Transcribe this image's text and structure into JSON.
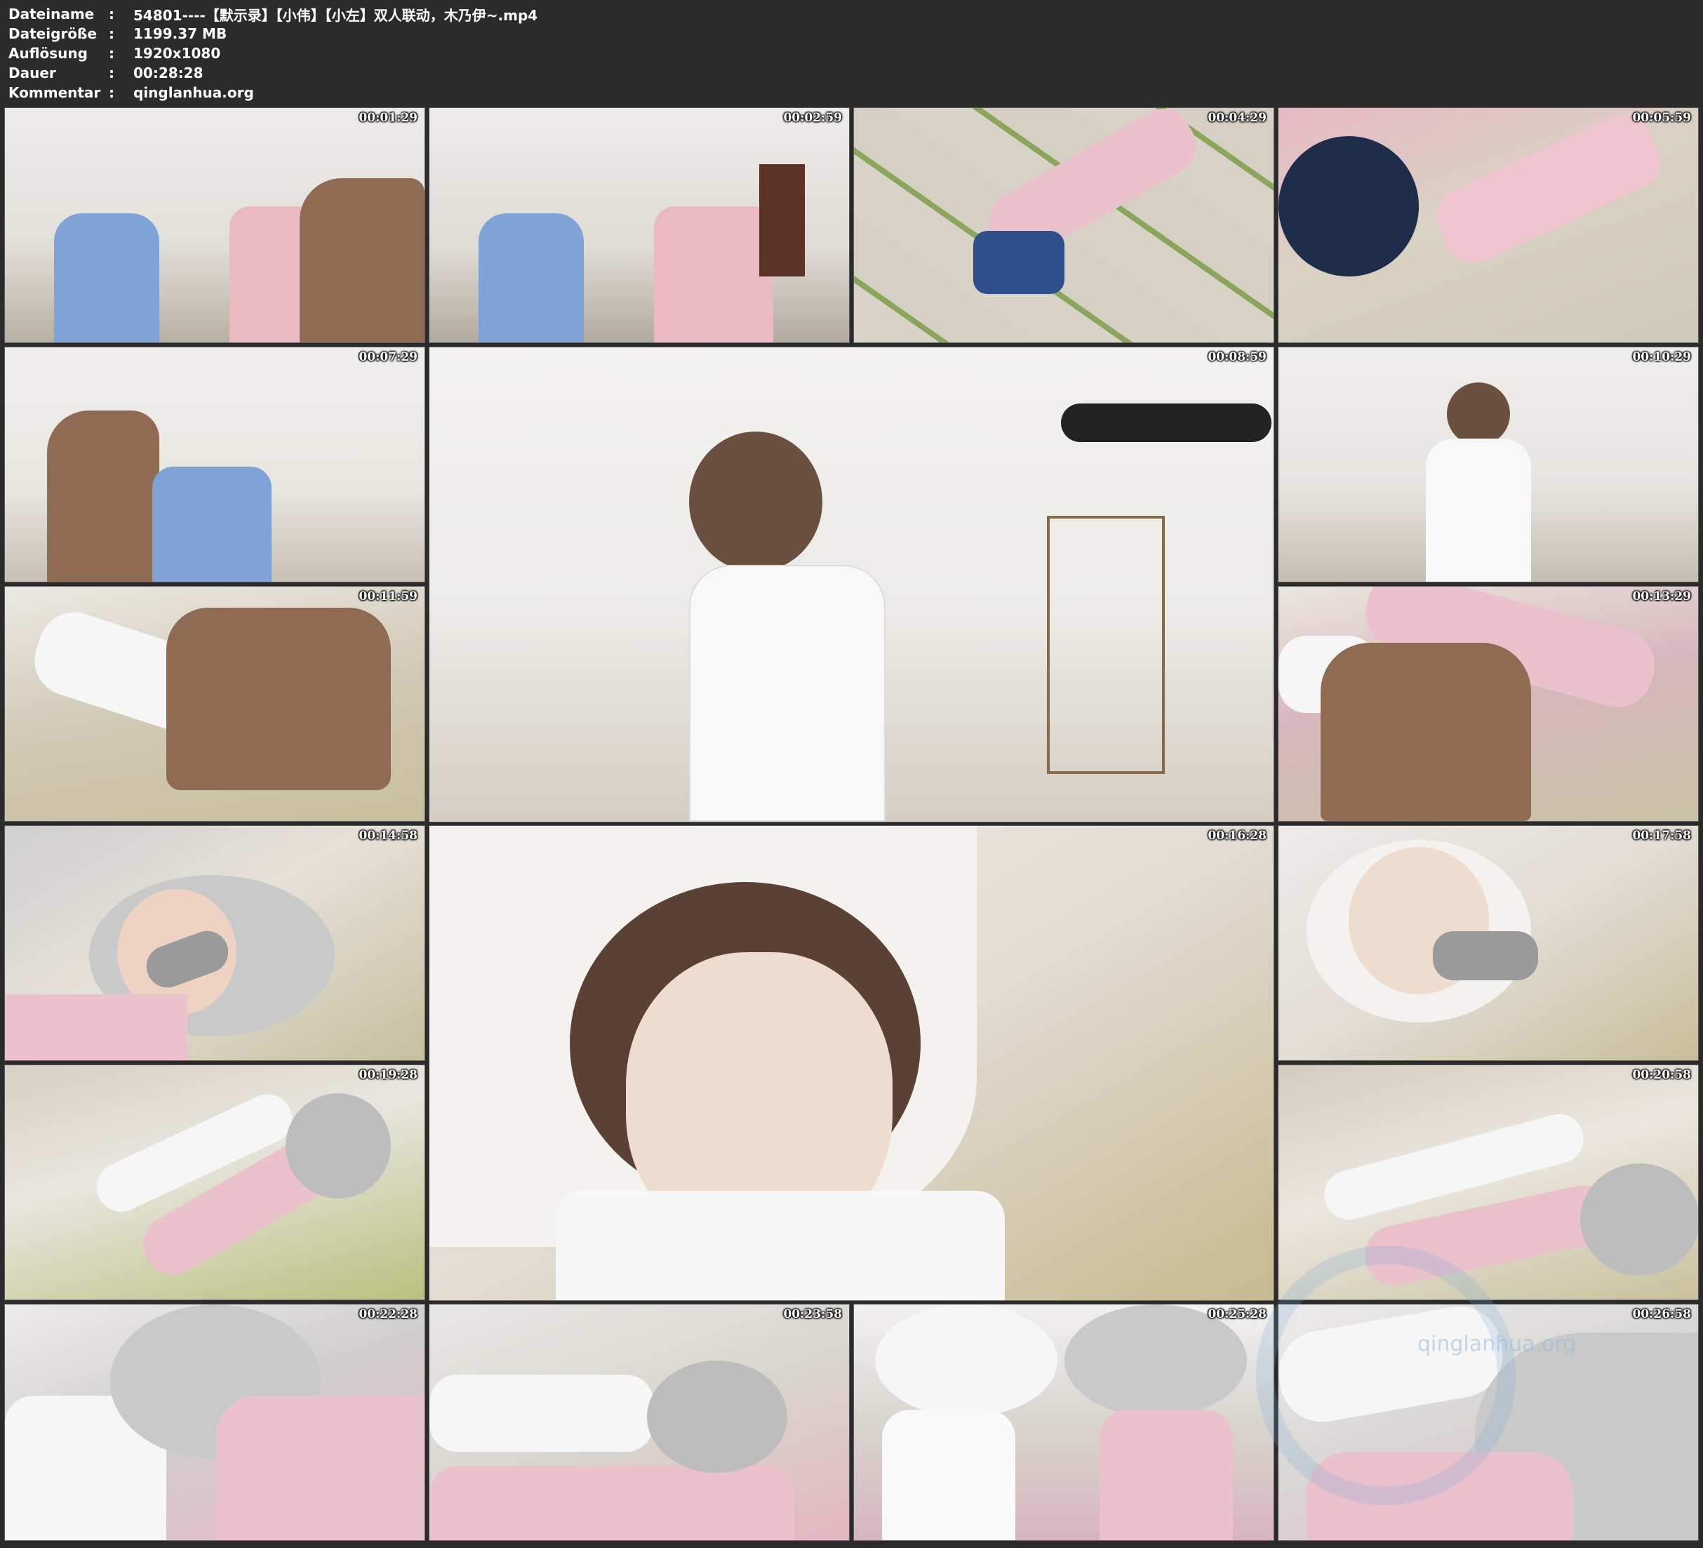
{
  "header": {
    "rows": [
      {
        "label": "Dateiname",
        "colon": ":",
        "value": "54801----【默示录】【小伟】【小左】双人联动，木乃伊~.mp4"
      },
      {
        "label": "Dateigröße",
        "colon": ":",
        "value": "1199.37 MB"
      },
      {
        "label": "Auflösung",
        "colon": ":",
        "value": "1920x1080"
      },
      {
        "label": "Dauer",
        "colon": ":",
        "value": "00:28:28"
      },
      {
        "label": "Kommentar",
        "colon": ":",
        "value": "qinglanhua.org"
      }
    ]
  },
  "thumbnails": [
    {
      "timestamp": "00:01:29"
    },
    {
      "timestamp": "00:02:59"
    },
    {
      "timestamp": "00:04:29"
    },
    {
      "timestamp": "00:05:59"
    },
    {
      "timestamp": "00:07:29"
    },
    {
      "timestamp": "00:08:59"
    },
    {
      "timestamp": "00:10:29"
    },
    {
      "timestamp": "00:11:59"
    },
    {
      "timestamp": "00:13:29"
    },
    {
      "timestamp": "00:14:58"
    },
    {
      "timestamp": "00:16:28"
    },
    {
      "timestamp": "00:17:58"
    },
    {
      "timestamp": "00:19:28"
    },
    {
      "timestamp": "00:20:58"
    },
    {
      "timestamp": "00:22:28"
    },
    {
      "timestamp": "00:23:58"
    },
    {
      "timestamp": "00:25:28"
    },
    {
      "timestamp": "00:26:58"
    }
  ],
  "watermark": {
    "text": "qinglanhua.org"
  }
}
